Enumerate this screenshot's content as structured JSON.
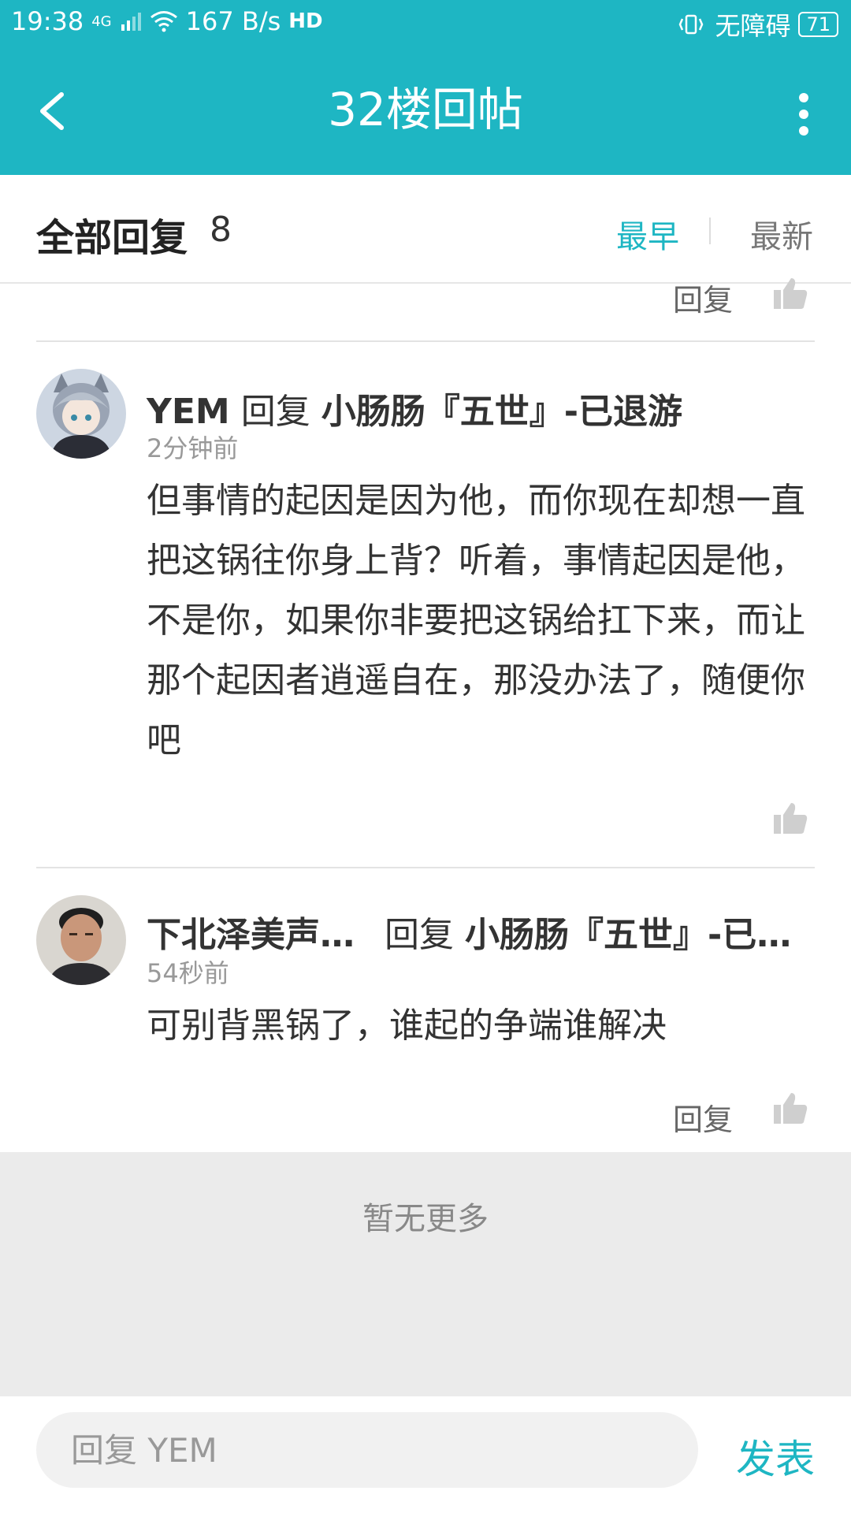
{
  "status": {
    "time": "19:38",
    "network": "4G",
    "speed": "167 B/s",
    "hd": "HD",
    "accessibility": "无障碍",
    "battery": "71"
  },
  "header": {
    "title": "32楼回帖"
  },
  "sortbar": {
    "label": "全部回复",
    "count": "8",
    "earliest": "最早",
    "latest": "最新"
  },
  "actions": {
    "reply": "回复"
  },
  "replies": [
    {
      "author": "YEM",
      "reply_word": "回复",
      "target": "小肠肠『五世』-已退游",
      "time": "2分钟前",
      "content": "但事情的起因是因为他，而你现在却想一直把这锅往你身上背？听着，事情起因是他，不是你，如果你非要把这锅给扛下来，而让那个起因者逍遥自在，那没办法了，随便你吧"
    },
    {
      "author": "下北泽美声…",
      "reply_word": "回复",
      "target": "小肠肠『五世』-已…",
      "time": "54秒前",
      "content": "可别背黑锅了，谁起的争端谁解决"
    }
  ],
  "footer_note": "暂无更多",
  "input": {
    "placeholder": "回复 YEM",
    "send_label": "发表"
  },
  "colors": {
    "accent": "#1eb6c3"
  }
}
